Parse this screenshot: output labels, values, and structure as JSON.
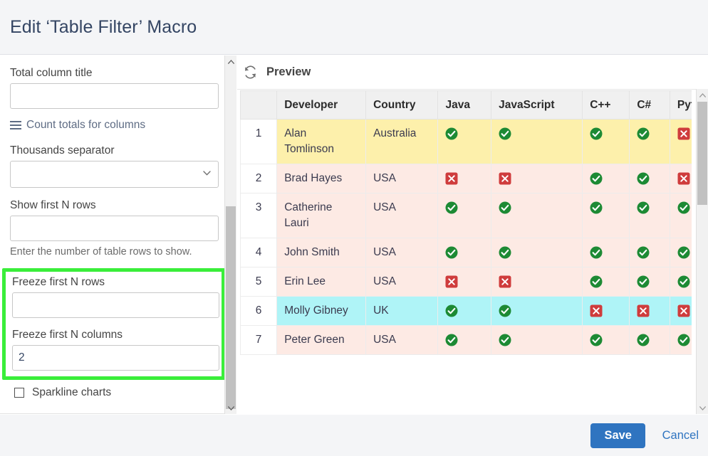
{
  "dialog": {
    "title": "Edit ‘Table Filter’ Macro"
  },
  "form": {
    "top_select": {
      "name": "top-select",
      "value": "",
      "caret": "chevron-down-icon"
    },
    "fields": [
      {
        "label": "Total column title",
        "value": "",
        "type": "text"
      },
      {
        "label": "Thousands separator",
        "value": "",
        "type": "select"
      },
      {
        "label": "Show first N rows",
        "value": "",
        "type": "text",
        "help": "Enter the number of table rows to show."
      },
      {
        "label": "Freeze first N rows",
        "value": "",
        "type": "text"
      },
      {
        "label": "Freeze first N columns",
        "value": "2",
        "type": "text"
      }
    ],
    "count_totals_link": "Count totals for columns",
    "count_totals_icon": "hamburger-icon",
    "sparkline_checkbox": {
      "label": "Sparkline charts",
      "checked": false
    },
    "highlight_color": "#3aee3a"
  },
  "preview": {
    "label": "Preview",
    "refresh_icon": "refresh-icon",
    "columns": [
      "",
      "Developer",
      "Country",
      "Java",
      "JavaScript",
      "C++",
      "C#",
      "Python"
    ],
    "rows": [
      {
        "num": "1",
        "developer": "Alan Tomlinson",
        "country": "Australia",
        "java": "yes",
        "javascript": "yes",
        "cpp": "yes",
        "cs": "yes",
        "python": "no",
        "highlight": "yellow"
      },
      {
        "num": "2",
        "developer": "Brad Hayes",
        "country": "USA",
        "java": "no",
        "javascript": "no",
        "cpp": "yes",
        "cs": "yes",
        "python": "no",
        "highlight": "pink"
      },
      {
        "num": "3",
        "developer": "Catherine Lauri",
        "country": "USA",
        "java": "yes",
        "javascript": "yes",
        "cpp": "yes",
        "cs": "yes",
        "python": "yes",
        "highlight": "pink"
      },
      {
        "num": "4",
        "developer": "John Smith",
        "country": "USA",
        "java": "yes",
        "javascript": "yes",
        "cpp": "yes",
        "cs": "yes",
        "python": "yes",
        "highlight": "pink"
      },
      {
        "num": "5",
        "developer": "Erin Lee",
        "country": "USA",
        "java": "no",
        "javascript": "no",
        "cpp": "yes",
        "cs": "yes",
        "python": "yes",
        "highlight": "pink"
      },
      {
        "num": "6",
        "developer": "Molly Gibney",
        "country": "UK",
        "java": "yes",
        "javascript": "yes",
        "cpp": "no",
        "cs": "no",
        "python": "no",
        "highlight": "cyan"
      },
      {
        "num": "7",
        "developer": "Peter Green",
        "country": "USA",
        "java": "yes",
        "javascript": "yes",
        "cpp": "yes",
        "cs": "yes",
        "python": "yes",
        "highlight": "pink"
      }
    ],
    "mark_yes_color": "#1d8a34",
    "mark_no_color": "#cf3c3c",
    "row_colors": {
      "yellow": "#fdf0ab",
      "pink": "#fdeae4",
      "cyan": "#aff4f7"
    }
  },
  "footer": {
    "save_label": "Save",
    "cancel_label": "Cancel",
    "save_color": "#2f74c0"
  }
}
